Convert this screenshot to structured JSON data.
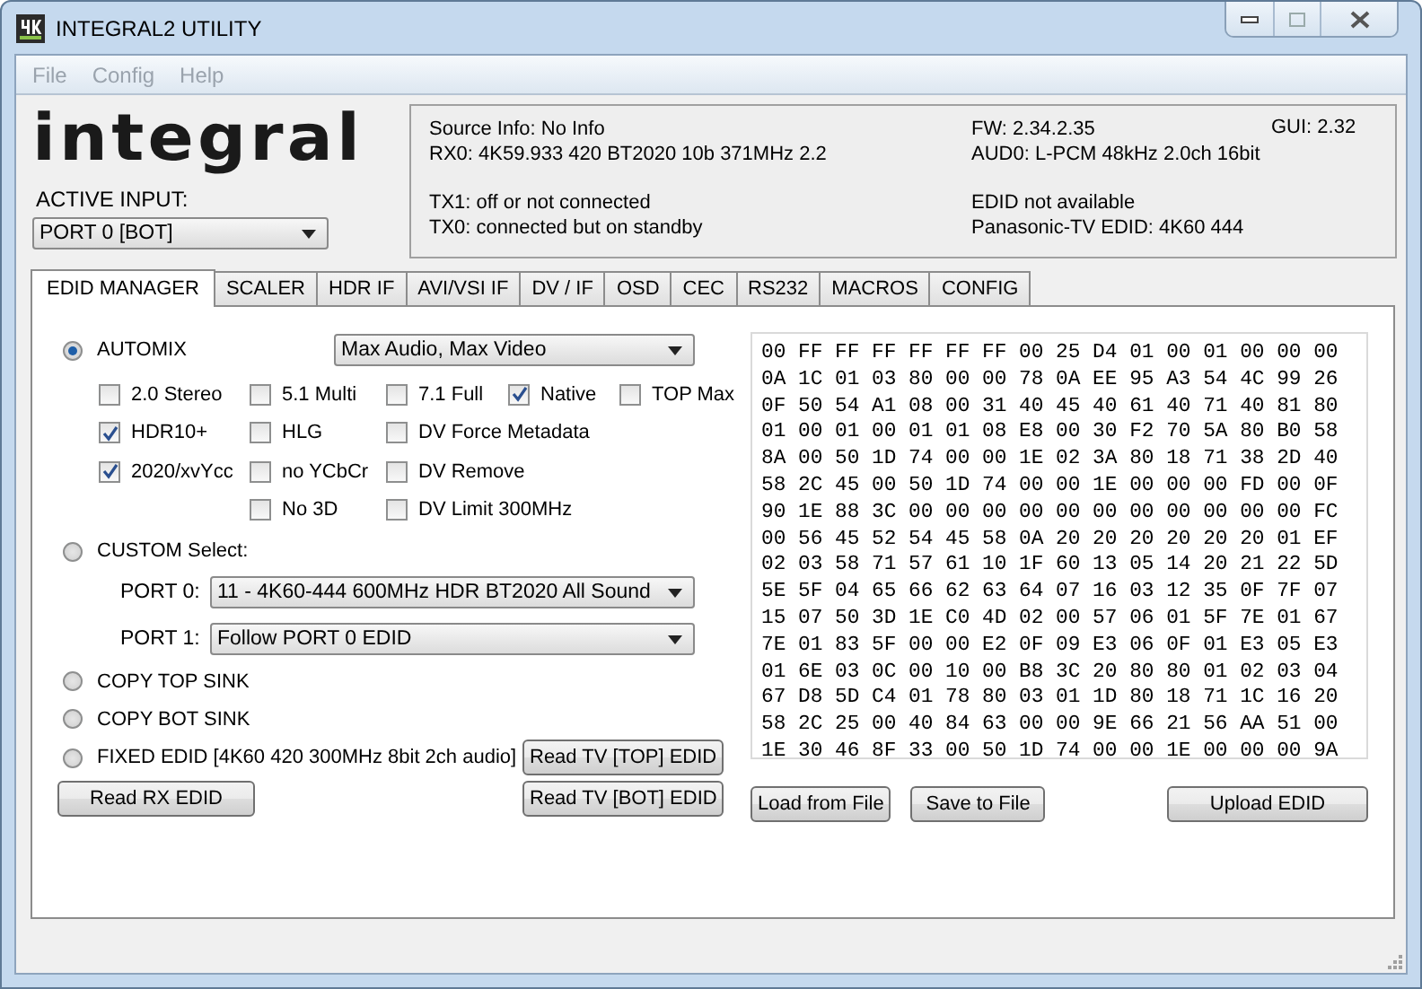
{
  "window": {
    "title": "INTEGRAL2 UTILITY"
  },
  "menu": [
    "File",
    "Config",
    "Help"
  ],
  "logo": "integral",
  "active_input": {
    "label": "ACTIVE INPUT:",
    "value": "PORT 0 [BOT]"
  },
  "info": {
    "left_groups": [
      [
        "Source Info: No Info",
        "RX0: 4K59.933 420 BT2020 10b 371MHz 2.2"
      ],
      [
        "TX1: off or not connected",
        "TX0: connected but on standby"
      ]
    ],
    "right_groups": [
      [
        "FW: 2.34.2.35",
        "AUD0: L-PCM 48kHz 2.0ch 16bit"
      ],
      [
        "EDID not available",
        "Panasonic-TV EDID: 4K60 444"
      ]
    ],
    "gui": "GUI: 2.32"
  },
  "tabs": [
    {
      "label": "EDID MANAGER",
      "selected": true
    },
    {
      "label": "SCALER",
      "selected": false
    },
    {
      "label": "HDR IF",
      "selected": false
    },
    {
      "label": "AVI/VSI IF",
      "selected": false
    },
    {
      "label": "DV / IF",
      "selected": false
    },
    {
      "label": "OSD",
      "selected": false
    },
    {
      "label": "CEC",
      "selected": false
    },
    {
      "label": "RS232",
      "selected": false
    },
    {
      "label": "MACROS",
      "selected": false
    },
    {
      "label": "CONFIG",
      "selected": false
    }
  ],
  "modes": [
    {
      "kind": "automix",
      "label": "AUTOMIX",
      "selected": true,
      "dropdown": "Max Audio, Max Video"
    },
    {
      "kind": "custom",
      "label": "CUSTOM Select:",
      "selected": false,
      "ports": [
        {
          "label": "PORT 0:",
          "value": "11 - 4K60-444 600MHz HDR BT2020 All Sound"
        },
        {
          "label": "PORT 1:",
          "value": "Follow PORT 0 EDID"
        }
      ]
    },
    {
      "kind": "plain",
      "label": "COPY TOP SINK",
      "selected": false
    },
    {
      "kind": "plain",
      "label": "COPY BOT SINK",
      "selected": false
    },
    {
      "kind": "fixed",
      "label": "FIXED EDID [4K60 420 300MHz 8bit 2ch audio]",
      "selected": false
    }
  ],
  "checkbox_columns": [
    [
      {
        "label": "2.0 Stereo",
        "checked": false
      },
      {
        "label": "HDR10+",
        "checked": true
      },
      {
        "label": "2020/xvYcc",
        "checked": true
      }
    ],
    [
      {
        "label": "5.1 Multi",
        "checked": false
      },
      {
        "label": "HLG",
        "checked": false
      },
      {
        "label": "no YCbCr",
        "checked": false
      },
      {
        "label": "No 3D",
        "checked": false
      }
    ],
    [
      {
        "label": "7.1 Full",
        "checked": false
      },
      {
        "label": "DV Force Metadata",
        "checked": false
      },
      {
        "label": "DV Remove",
        "checked": false
      },
      {
        "label": "DV Limit 300MHz",
        "checked": false
      }
    ],
    [
      {
        "label": "Native",
        "checked": true
      }
    ],
    [
      {
        "label": "TOP Max",
        "checked": false
      }
    ]
  ],
  "buttons": {
    "read_tv_top": "Read TV [TOP] EDID",
    "read_rx": "Read RX  EDID",
    "read_tv_bot": "Read TV [BOT] EDID",
    "load": "Load from File",
    "save": "Save to File",
    "upload": "Upload EDID"
  },
  "hex_lines": [
    "00 FF FF FF FF FF FF 00 25 D4 01 00 01 00 00 00",
    "0A 1C 01 03 80 00 00 78 0A EE 95 A3 54 4C 99 26",
    "0F 50 54 A1 08 00 31 40 45 40 61 40 71 40 81 80",
    "01 00 01 00 01 01 08 E8 00 30 F2 70 5A 80 B0 58",
    "8A 00 50 1D 74 00 00 1E 02 3A 80 18 71 38 2D 40",
    "58 2C 45 00 50 1D 74 00 00 1E 00 00 00 FD 00 0F",
    "90 1E 88 3C 00 00 00 00 00 00 00 00 00 00 00 FC",
    "00 56 45 52 54 45 58 0A 20 20 20 20 20 20 01 EF",
    "02 03 58 71 57 61 10 1F 60 13 05 14 20 21 22 5D",
    "5E 5F 04 65 66 62 63 64 07 16 03 12 35 0F 7F 07",
    "15 07 50 3D 1E C0 4D 02 00 57 06 01 5F 7E 01 67",
    "7E 01 83 5F 00 00 E2 0F 09 E3 06 0F 01 E3 05 E3",
    "01 6E 03 0C 00 10 00 B8 3C 20 80 80 01 02 03 04",
    "67 D8 5D C4 01 78 80 03 01 1D 80 18 71 1C 16 20",
    "58 2C 25 00 40 84 63 00 00 9E 66 21 56 AA 51 00",
    "1E 30 46 8F 33 00 50 1D 74 00 00 1E 00 00 00 9A"
  ]
}
